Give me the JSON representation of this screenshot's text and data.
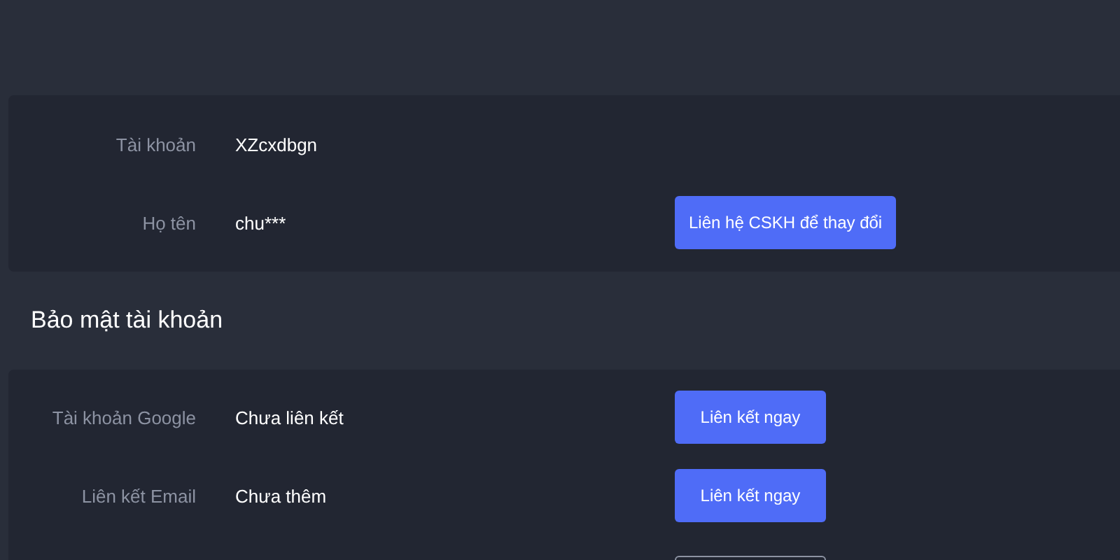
{
  "profile_rows": [
    {
      "label": "Tài khoản",
      "value": "XZcxdbgn"
    },
    {
      "label": "Họ tên",
      "value": "chu***",
      "button": "Liên hệ CSKH để thay đổi"
    }
  ],
  "security_section": {
    "title": "Bảo mật tài khoản",
    "rows": [
      {
        "label": "Tài khoản Google",
        "value": "Chưa liên kết",
        "button": "Liên kết ngay"
      },
      {
        "label": "Liên kết Email",
        "value": "Chưa thêm",
        "button": "Liên kết ngay"
      }
    ],
    "cut_off_control": {
      "kind": "outline"
    }
  }
}
